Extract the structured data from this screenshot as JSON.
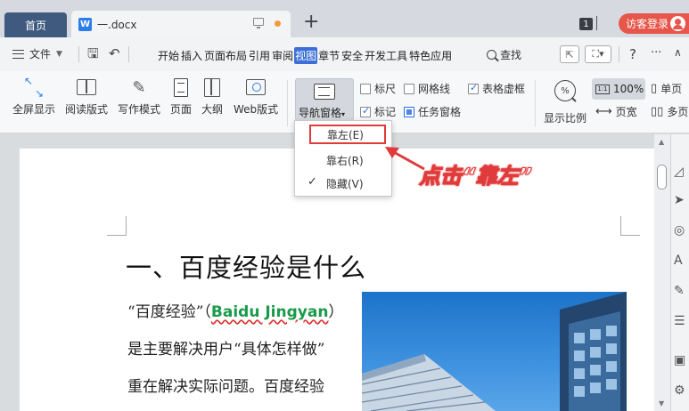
{
  "titlebar": {
    "home_tab": "首页",
    "doc_tab_icon": "W",
    "doc_tab": "一.docx",
    "new_tab": "+",
    "count_badge": "1",
    "login_button": "访客登录"
  },
  "menubar": {
    "file": "文件",
    "tabs": [
      "开始",
      "插入",
      "页面布局",
      "引用",
      "审阅",
      "视图",
      "章节",
      "安全",
      "开发工具",
      "特色应用"
    ],
    "active_tab": "视图",
    "search": "查找",
    "help": "?"
  },
  "ribbon": {
    "fullscreen": "全屏显示",
    "reading_mode": "阅读版式",
    "writing_mode": "写作模式",
    "page": "页面",
    "outline": "大纲",
    "web_layout": "Web版式",
    "nav_pane": "导航窗格",
    "ruler": "标尺",
    "gridlines": "网格线",
    "table_gridlines": "表格虚框",
    "marks": "标记",
    "task_pane": "任务窗格",
    "zoom": "显示比例",
    "zoom_value": "100%",
    "page_width": "页宽",
    "single_page": "单页",
    "multi_page": "多页"
  },
  "checkboxes": {
    "ruler": false,
    "gridlines": false,
    "table_gridlines": true,
    "marks": true,
    "task_pane": true
  },
  "nav_dropdown": {
    "items": [
      "靠左(E)",
      "靠右(R)",
      "隐藏(V)"
    ],
    "highlighted": "靠左(E)",
    "checked": "隐藏(V)"
  },
  "annotation": {
    "text": "点击“靠左”",
    "color": "#e03a3a"
  },
  "document": {
    "heading": "一、百度经验是什么",
    "line1_pre": "“百度经验”（",
    "line1_en": "Baidu Jingyan",
    "line1_post": "）",
    "line2": "是主要解决用户“具体怎样做”",
    "line3": "重在解决实际问题。百度经验"
  },
  "colors": {
    "accent": "#3b6fd6",
    "home_tab": "#3f5a7e",
    "login": "#e6564a"
  }
}
